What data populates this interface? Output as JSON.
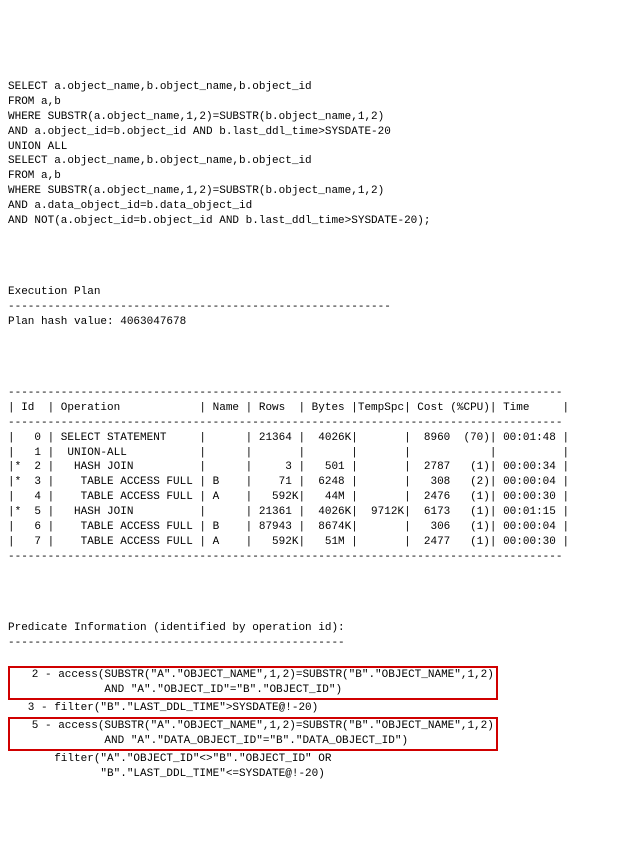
{
  "sql": {
    "l1": "SELECT a.object_name,b.object_name,b.object_id",
    "l2": "FROM a,b",
    "l3": "WHERE SUBSTR(a.object_name,1,2)=SUBSTR(b.object_name,1,2)",
    "l4": "AND a.object_id=b.object_id AND b.last_ddl_time>SYSDATE-20",
    "l5": "UNION ALL",
    "l6": "SELECT a.object_name,b.object_name,b.object_id",
    "l7": "FROM a,b",
    "l8": "WHERE SUBSTR(a.object_name,1,2)=SUBSTR(b.object_name,1,2)",
    "l9": "AND a.data_object_id=b.data_object_id",
    "l10": "AND NOT(a.object_id=b.object_id AND b.last_ddl_time>SYSDATE-20);"
  },
  "plan_header": {
    "title": "Execution Plan",
    "dash1": "----------------------------------------------------------",
    "hash": "Plan hash value: 4063047678"
  },
  "table": {
    "rule": "------------------------------------------------------------------------------------",
    "head": "| Id  | Operation            | Name | Rows  | Bytes |TempSpc| Cost (%CPU)| Time     |",
    "rows": [
      "|   0 | SELECT STATEMENT     |      | 21364 |  4026K|       |  8960  (70)| 00:01:48 |",
      "|   1 |  UNION-ALL           |      |       |       |       |            |          |",
      "|*  2 |   HASH JOIN          |      |     3 |   501 |       |  2787   (1)| 00:00:34 |",
      "|*  3 |    TABLE ACCESS FULL | B    |    71 |  6248 |       |   308   (2)| 00:00:04 |",
      "|   4 |    TABLE ACCESS FULL | A    |   592K|   44M |       |  2476   (1)| 00:00:30 |",
      "|*  5 |   HASH JOIN          |      | 21361 |  4026K|  9712K|  6173   (1)| 00:01:15 |",
      "|   6 |    TABLE ACCESS FULL | B    | 87943 |  8674K|       |   306   (1)| 00:00:04 |",
      "|   7 |    TABLE ACCESS FULL | A    |   592K|   51M |       |  2477   (1)| 00:00:30 |"
    ]
  },
  "pred": {
    "title": "Predicate Information (identified by operation id):",
    "dash": "---------------------------------------------------",
    "p2a": "   2 - access(SUBSTR(\"A\".\"OBJECT_NAME\",1,2)=SUBSTR(\"B\".\"OBJECT_NAME\",1,2)",
    "p2b": "              AND \"A\".\"OBJECT_ID\"=\"B\".\"OBJECT_ID\")",
    "p3": "   3 - filter(\"B\".\"LAST_DDL_TIME\">SYSDATE@!-20)",
    "p5a": "   5 - access(SUBSTR(\"A\".\"OBJECT_NAME\",1,2)=SUBSTR(\"B\".\"OBJECT_NAME\",1,2)",
    "p5b": "              AND \"A\".\"DATA_OBJECT_ID\"=\"B\".\"DATA_OBJECT_ID\")",
    "p5c": "       filter(\"A\".\"OBJECT_ID\"<>\"B\".\"OBJECT_ID\" OR",
    "p5d": "              \"B\".\"LAST_DDL_TIME\"<=SYSDATE@!-20)"
  },
  "chart_data": {
    "type": "table",
    "title": "Execution Plan",
    "plan_hash_value": 4063047678,
    "columns": [
      "Id",
      "Operation",
      "Name",
      "Rows",
      "Bytes",
      "TempSpc",
      "Cost",
      "%CPU",
      "Time"
    ],
    "rows": [
      {
        "Id": 0,
        "star": false,
        "Operation": "SELECT STATEMENT",
        "Name": "",
        "Rows": 21364,
        "Bytes": "4026K",
        "TempSpc": "",
        "Cost": 8960,
        "%CPU": 70,
        "Time": "00:01:48"
      },
      {
        "Id": 1,
        "star": false,
        "Operation": "UNION-ALL",
        "Name": "",
        "Rows": null,
        "Bytes": "",
        "TempSpc": "",
        "Cost": null,
        "%CPU": null,
        "Time": ""
      },
      {
        "Id": 2,
        "star": true,
        "Operation": "HASH JOIN",
        "Name": "",
        "Rows": 3,
        "Bytes": "501",
        "TempSpc": "",
        "Cost": 2787,
        "%CPU": 1,
        "Time": "00:00:34"
      },
      {
        "Id": 3,
        "star": true,
        "Operation": "TABLE ACCESS FULL",
        "Name": "B",
        "Rows": 71,
        "Bytes": "6248",
        "TempSpc": "",
        "Cost": 308,
        "%CPU": 2,
        "Time": "00:00:04"
      },
      {
        "Id": 4,
        "star": false,
        "Operation": "TABLE ACCESS FULL",
        "Name": "A",
        "Rows": "592K",
        "Bytes": "44M",
        "TempSpc": "",
        "Cost": 2476,
        "%CPU": 1,
        "Time": "00:00:30"
      },
      {
        "Id": 5,
        "star": true,
        "Operation": "HASH JOIN",
        "Name": "",
        "Rows": 21361,
        "Bytes": "4026K",
        "TempSpc": "9712K",
        "Cost": 6173,
        "%CPU": 1,
        "Time": "00:01:15"
      },
      {
        "Id": 6,
        "star": false,
        "Operation": "TABLE ACCESS FULL",
        "Name": "B",
        "Rows": 87943,
        "Bytes": "8674K",
        "TempSpc": "",
        "Cost": 306,
        "%CPU": 1,
        "Time": "00:00:04"
      },
      {
        "Id": 7,
        "star": false,
        "Operation": "TABLE ACCESS FULL",
        "Name": "A",
        "Rows": "592K",
        "Bytes": "51M",
        "TempSpc": "",
        "Cost": 2477,
        "%CPU": 1,
        "Time": "00:00:30"
      }
    ],
    "predicates": [
      {
        "id": 2,
        "type": "access",
        "expr": "SUBSTR(\"A\".\"OBJECT_NAME\",1,2)=SUBSTR(\"B\".\"OBJECT_NAME\",1,2) AND \"A\".\"OBJECT_ID\"=\"B\".\"OBJECT_ID\""
      },
      {
        "id": 3,
        "type": "filter",
        "expr": "\"B\".\"LAST_DDL_TIME\">SYSDATE@!-20"
      },
      {
        "id": 5,
        "type": "access",
        "expr": "SUBSTR(\"A\".\"OBJECT_NAME\",1,2)=SUBSTR(\"B\".\"OBJECT_NAME\",1,2) AND \"A\".\"DATA_OBJECT_ID\"=\"B\".\"DATA_OBJECT_ID\""
      },
      {
        "id": 5,
        "type": "filter",
        "expr": "\"A\".\"OBJECT_ID\"<>\"B\".\"OBJECT_ID\" OR \"B\".\"LAST_DDL_TIME\"<=SYSDATE@!-20"
      }
    ]
  }
}
